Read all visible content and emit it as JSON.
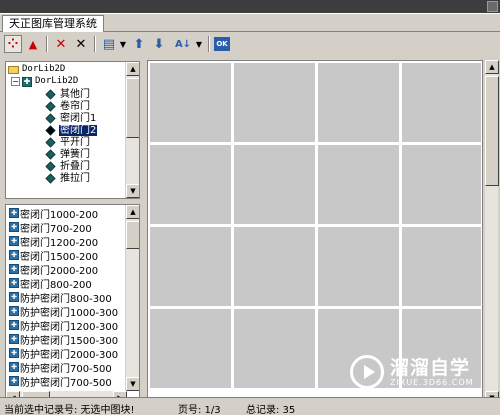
{
  "tab": {
    "title": "天正图库管理系统"
  },
  "toolbar": {
    "buttons": [
      {
        "name": "multi-view-icon",
        "glyph": "⁘"
      },
      {
        "name": "triangle-icon",
        "glyph": "▲"
      },
      {
        "name": "delete-icon",
        "glyph": "✕"
      },
      {
        "name": "cut-icon",
        "glyph": "✕"
      },
      {
        "name": "layout-icon",
        "glyph": "▤"
      },
      {
        "name": "up-arrow-icon",
        "glyph": "⬆"
      },
      {
        "name": "down-arrow-icon",
        "glyph": "⬇"
      },
      {
        "name": "sort-icon",
        "glyph": "A↓"
      },
      {
        "name": "ok-icon",
        "glyph": "OK"
      }
    ],
    "colors": {
      "red": "#cc0000",
      "blue": "#2a5fa8",
      "black": "#000000"
    }
  },
  "tree": {
    "root": "DorLib2D",
    "library": "DorLib2D",
    "items": [
      "其他门",
      "卷帘门",
      "密闭门1",
      "密闭门2",
      "平开门",
      "弹簧门",
      "折叠门",
      "推拉门"
    ],
    "selected_index": 3
  },
  "list": {
    "items": [
      "密闭门1000-200",
      "密闭门700-200",
      "密闭门1200-200",
      "密闭门1500-200",
      "密闭门2000-200",
      "密闭门800-200",
      "防护密闭门800-300",
      "防护密闭门1000-300",
      "防护密闭门1200-300",
      "防护密闭门1500-300",
      "防护密闭门2000-300",
      "防护密闭门700-500",
      "防护密闭门700-500"
    ]
  },
  "status": {
    "current_record": "当前选中记录号: 无选中图块!",
    "page": "页号: 1/3",
    "total": "总记录:  35"
  },
  "watermark": {
    "title": "溜溜自学",
    "subtitle": "ZIXUE.3D66.COM"
  }
}
